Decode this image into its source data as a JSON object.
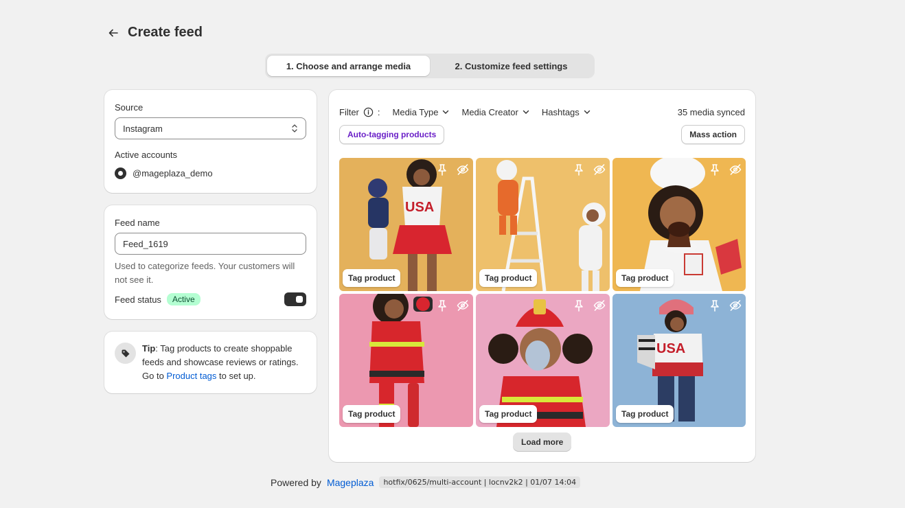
{
  "header": {
    "title": "Create feed"
  },
  "stepper": {
    "step1": "1. Choose and arrange media",
    "step2": "2. Customize feed settings"
  },
  "source_card": {
    "source_label": "Source",
    "source_value": "Instagram",
    "accounts_label": "Active accounts",
    "account": "@mageplaza_demo"
  },
  "feed_card": {
    "name_label": "Feed name",
    "name_value": "Feed_1619",
    "help": "Used to categorize feeds. Your customers will not see it.",
    "status_label": "Feed status",
    "status_badge": "Active"
  },
  "tip_card": {
    "bold": "Tip",
    "text1": ": Tag products to create shoppable feeds and showcase reviews or ratings. Go to ",
    "link": "Product tags",
    "text2": " to set up."
  },
  "media": {
    "filter_label": "Filter",
    "filter_sep": ":",
    "dropdowns": [
      "Media Type",
      "Media Creator",
      "Hashtags"
    ],
    "synced": "35 media synced",
    "auto_tag": "Auto-tagging products",
    "mass_action": "Mass action",
    "tag_label": "Tag product",
    "load_more": "Load more",
    "tiles": [
      {
        "bg": "#e7b55a"
      },
      {
        "bg": "#f0c06a"
      },
      {
        "bg": "#f0bb55"
      },
      {
        "bg": "#ee9db4"
      },
      {
        "bg": "#eaa6c2"
      },
      {
        "bg": "#8fb5d8"
      }
    ]
  },
  "footer": {
    "powered": "Powered by",
    "brand": "Mageplaza",
    "version": "hotfix/0625/multi-account | locnv2k2 | 01/07 14:04"
  }
}
